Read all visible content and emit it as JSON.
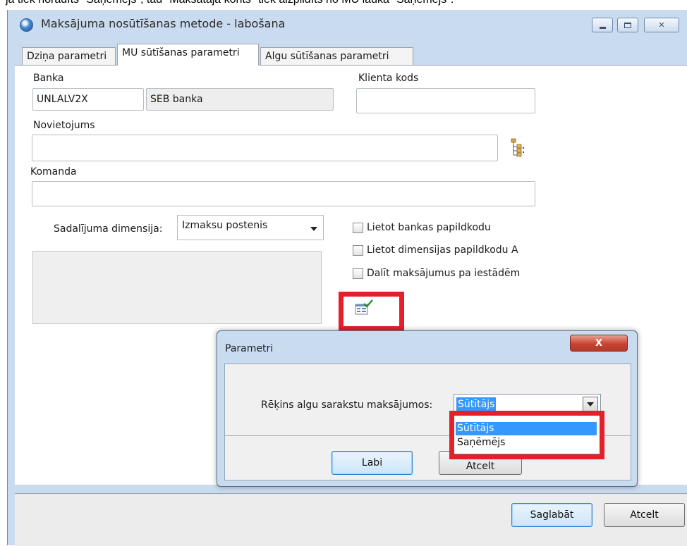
{
  "doc_text": "ja tiek norādīts \"Saņēmējs\", tad \"Maksātāja konts\" tiek aizpildīts no MU lauka \"Saņēmējs\".",
  "window": {
    "title": "Maksājuma nosūtīšanas metode - labošana",
    "close_glyph": "✕"
  },
  "tabs": [
    {
      "label": "Dziņa parametri"
    },
    {
      "label": "MU sūtīšanas parametri"
    },
    {
      "label": "Algu sūtīšanas parametri"
    }
  ],
  "form": {
    "bank_label": "Banka",
    "bank_code": "UNLALV2X",
    "bank_name": "SEB banka",
    "client_code_label": "Klienta kods",
    "client_code_value": "",
    "location_label": "Novietojums",
    "location_value": "",
    "command_label": "Komanda",
    "command_value": "",
    "dimension_label": "Sadalījuma dimensija:",
    "dimension_value": "Izmaksu postenis",
    "checkboxes": [
      {
        "label": "Lietot bankas papildkodu",
        "checked": false
      },
      {
        "label": "Lietot dimensijas papildkodu A",
        "checked": false
      },
      {
        "label": "Dalīt maksājumus pa iestādēm",
        "checked": false
      }
    ]
  },
  "buttons": {
    "save": "Saglabāt",
    "cancel": "Atcelt"
  },
  "dialog": {
    "title": "Parametri",
    "close_glyph": "X",
    "account_label": "Rēķins algu sarakstu maksājumos:",
    "account_value": "Sūtītājs",
    "options": [
      "Sūtītājs",
      "Saņēmējs"
    ],
    "ok": "Labi",
    "cancel": "Atcelt"
  },
  "colors": {
    "highlight_red": "#e4202b",
    "selection_blue": "#3399ff",
    "window_frame": "#c9dbef"
  }
}
